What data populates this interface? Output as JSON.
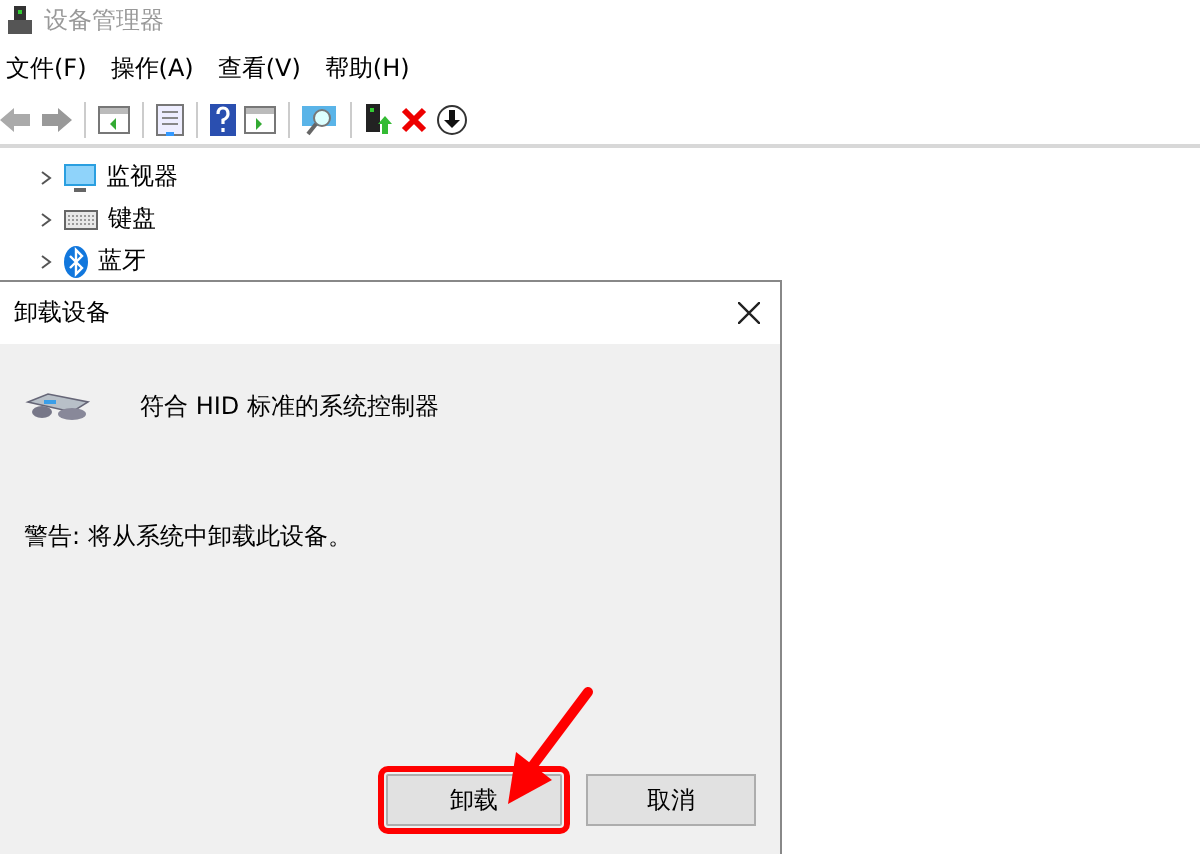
{
  "window": {
    "title": "设备管理器"
  },
  "menu": [
    "文件(F)",
    "操作(A)",
    "查看(V)",
    "帮助(H)"
  ],
  "tree": [
    {
      "label": "监视器",
      "kind": "monitor",
      "expanded": false
    },
    {
      "label": "键盘",
      "kind": "keyboard",
      "expanded": false
    },
    {
      "label": "蓝牙",
      "kind": "bluetooth",
      "expanded": false
    }
  ],
  "dialog": {
    "title": "卸载设备",
    "device": "符合 HID 标准的系统控制器",
    "warning": "警告: 将从系统中卸载此设备。",
    "buttons": [
      {
        "label": "卸载",
        "highlighted": true
      },
      {
        "label": "取消",
        "highlighted": false
      }
    ]
  }
}
